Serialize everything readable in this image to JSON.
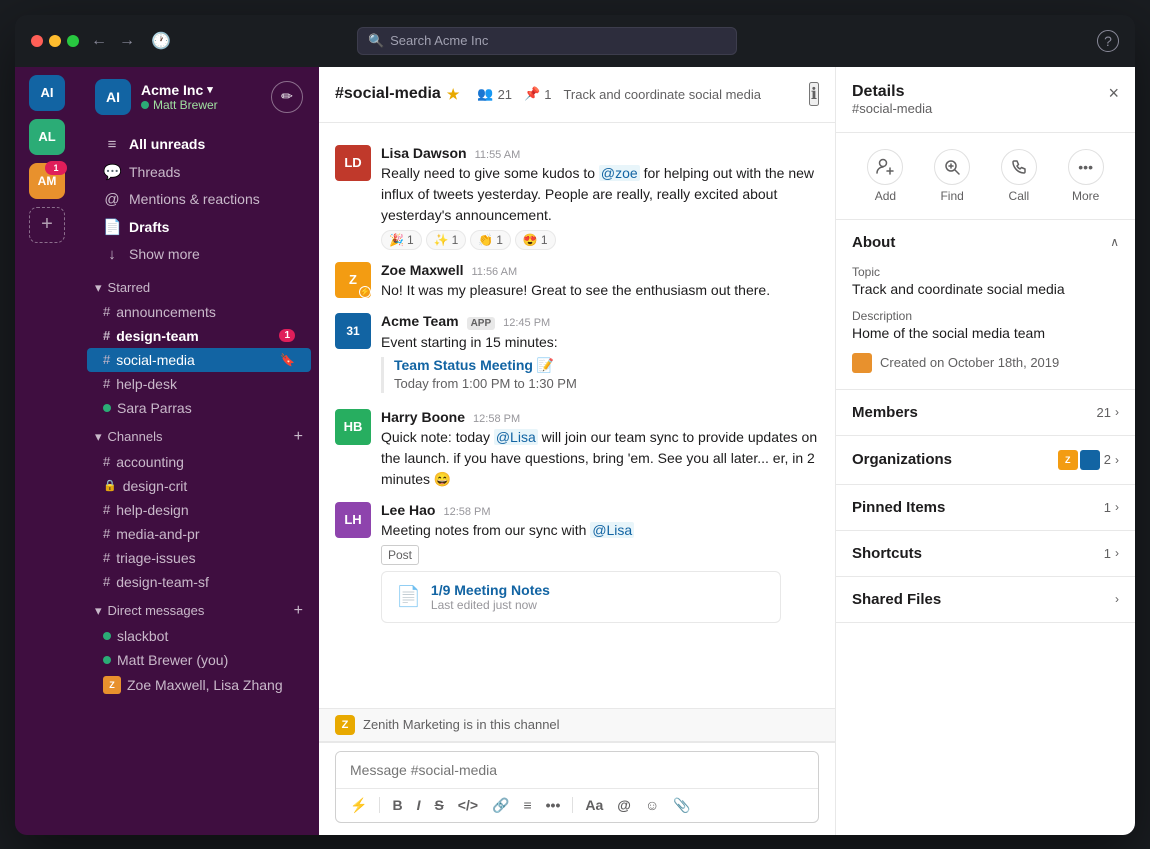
{
  "window": {
    "title": "Acme Inc"
  },
  "titlebar": {
    "search_placeholder": "Search Acme Inc",
    "back_label": "←",
    "forward_label": "→",
    "history_label": "🕐",
    "help_label": "?"
  },
  "sidebar": {
    "workspace_name": "Acme Inc",
    "workspace_dropdown": "▾",
    "user_name": "Matt Brewer",
    "compose_label": "✏",
    "outer_icons": [
      {
        "id": "ai-icon",
        "label": "AI",
        "color": "#1264a3"
      },
      {
        "id": "al-icon",
        "label": "AL",
        "color": "#2bac76"
      },
      {
        "id": "am-icon",
        "label": "AM",
        "color": "#e8912d",
        "badge": true
      },
      {
        "id": "plus-icon",
        "label": "+",
        "color": "transparent"
      }
    ],
    "nav_items": [
      {
        "id": "all-unreads",
        "icon": "≡",
        "label": "All unreads",
        "bold": true
      },
      {
        "id": "threads",
        "icon": "💬",
        "label": "Threads"
      },
      {
        "id": "mentions",
        "icon": "@",
        "label": "Mentions & reactions"
      },
      {
        "id": "drafts",
        "icon": "📄",
        "label": "Drafts",
        "bold": true
      },
      {
        "id": "show-more",
        "icon": "↓",
        "label": "Show more"
      }
    ],
    "starred": {
      "label": "Starred",
      "channels": [
        {
          "id": "announcements",
          "prefix": "#",
          "name": "announcements"
        },
        {
          "id": "design-team",
          "prefix": "#",
          "name": "design-team",
          "bold": true,
          "badge": "1"
        },
        {
          "id": "social-media",
          "prefix": "#",
          "name": "social-media",
          "active": true,
          "bookmark": true
        },
        {
          "id": "help-desk",
          "prefix": "#",
          "name": "help-desk"
        },
        {
          "id": "sara-parras",
          "prefix": "●",
          "name": "Sara Parras",
          "dm": true,
          "online": true
        }
      ]
    },
    "channels": {
      "label": "Channels",
      "channels": [
        {
          "id": "accounting",
          "prefix": "#",
          "name": "accounting"
        },
        {
          "id": "design-crit",
          "prefix": "🔒",
          "name": "design-crit",
          "lock": true
        },
        {
          "id": "help-design",
          "prefix": "#",
          "name": "help-design"
        },
        {
          "id": "media-and-pr",
          "prefix": "#",
          "name": "media-and-pr"
        },
        {
          "id": "triage-issues",
          "prefix": "#",
          "name": "triage-issues"
        },
        {
          "id": "design-team-sf",
          "prefix": "#",
          "name": "design-team-sf"
        }
      ]
    },
    "direct_messages": {
      "label": "Direct messages",
      "items": [
        {
          "id": "slackbot",
          "name": "slackbot",
          "online": true,
          "bot": true
        },
        {
          "id": "matt-brewer",
          "name": "Matt Brewer (you)",
          "online": true
        },
        {
          "id": "zoe-lisa",
          "name": "Zoe Maxwell, Lisa Zhang",
          "multi": true
        }
      ]
    }
  },
  "chat": {
    "channel_name": "#social-media",
    "channel_star": "★",
    "members_count": "21",
    "pinned_count": "1",
    "description": "Track and coordinate social media",
    "messages": [
      {
        "id": "msg1",
        "sender": "Lisa Dawson",
        "time": "11:55 AM",
        "avatar_color": "#c0392b",
        "avatar_initials": "LD",
        "text": "Really need to give some kudos to @zoe for helping out with the new influx of tweets yesterday. People are really, really excited about yesterday's announcement.",
        "mention": "@zoe",
        "reactions": [
          {
            "emoji": "🎉",
            "count": "1"
          },
          {
            "emoji": "✨",
            "count": "1"
          },
          {
            "emoji": "👏",
            "count": "1"
          },
          {
            "emoji": "😍",
            "count": "1"
          }
        ]
      },
      {
        "id": "msg2",
        "sender": "Zoe Maxwell",
        "time": "11:56 AM",
        "avatar_color": "#f39c12",
        "avatar_initials": "Z",
        "text": "No! It was my pleasure! Great to see the enthusiasm out there."
      },
      {
        "id": "msg3",
        "sender": "Acme Team",
        "time": "12:45 PM",
        "avatar_color": "#1264a3",
        "avatar_initials": "31",
        "app_badge": "APP",
        "text": "Event starting in 15 minutes:",
        "quoted_link": "Team Status Meeting 📝",
        "quoted_sub": "Today from 1:00 PM to 1:30 PM"
      },
      {
        "id": "msg4",
        "sender": "Harry Boone",
        "time": "12:58 PM",
        "avatar_color": "#27ae60",
        "avatar_initials": "HB",
        "text": "Quick note: today @Lisa will join our team sync to provide updates on the launch. if you have questions, bring 'em. See you all later... er, in 2 minutes 😄",
        "mention": "@Lisa"
      },
      {
        "id": "msg5",
        "sender": "Lee Hao",
        "time": "12:58 PM",
        "avatar_color": "#8e44ad",
        "avatar_initials": "LH",
        "text": "Meeting notes from our sync with @Lisa",
        "mention": "@Lisa",
        "post_label": "Post",
        "post_title": "1/9 Meeting Notes",
        "post_meta": "Last edited just now"
      }
    ],
    "zenith_banner": "Zenith Marketing is in this channel",
    "input_placeholder": "Message #social-media",
    "toolbar": {
      "lightning": "⚡",
      "bold": "B",
      "italic": "I",
      "strikethrough": "S",
      "code": "</>",
      "link": "🔗",
      "list": "≡",
      "more": "•••",
      "font": "Aa",
      "mention": "@",
      "emoji": "☺",
      "attach": "📎"
    }
  },
  "details": {
    "title": "Details",
    "subtitle": "#social-media",
    "close_label": "×",
    "actions": [
      {
        "id": "add",
        "icon": "👤+",
        "label": "Add"
      },
      {
        "id": "find",
        "icon": "🔍",
        "label": "Find"
      },
      {
        "id": "call",
        "icon": "📞",
        "label": "Call"
      },
      {
        "id": "more",
        "icon": "•••",
        "label": "More"
      }
    ],
    "about": {
      "title": "About",
      "topic_label": "Topic",
      "topic_value": "Track and coordinate social media",
      "description_label": "Description",
      "description_value": "Home of the social media team",
      "created_text": "Created on October 18th, 2019"
    },
    "members": {
      "title": "Members",
      "count": "21"
    },
    "organizations": {
      "title": "Organizations",
      "count": "2"
    },
    "pinned_items": {
      "title": "Pinned Items",
      "count": "1"
    },
    "shortcuts": {
      "title": "Shortcuts",
      "count": "1"
    },
    "shared_files": {
      "title": "Shared Files"
    }
  }
}
